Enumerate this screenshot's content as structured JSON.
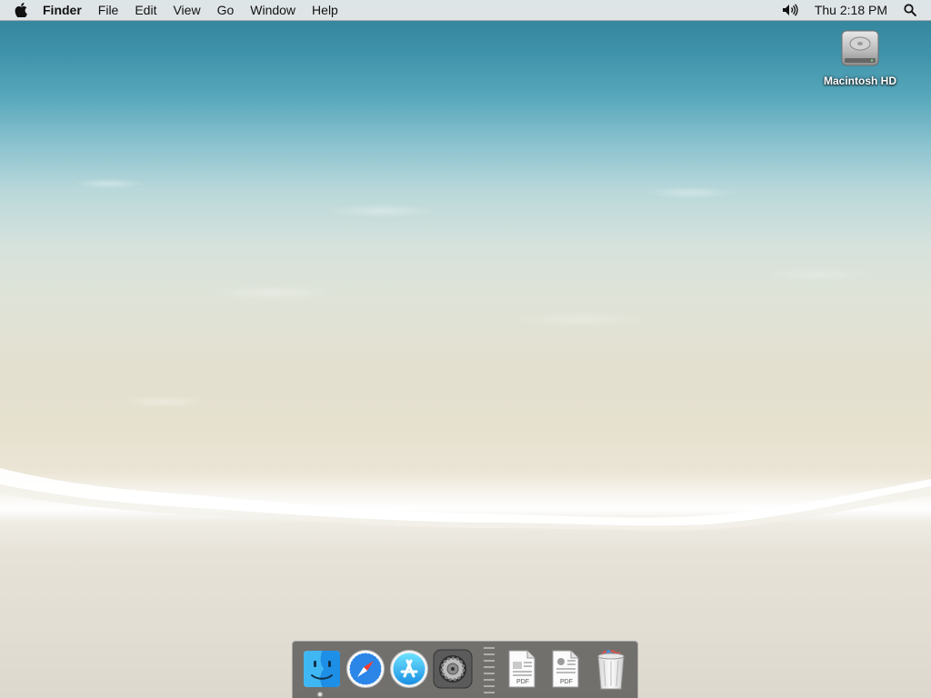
{
  "menubar": {
    "apple_icon": "apple-icon",
    "app_name": "Finder",
    "items": [
      "File",
      "Edit",
      "View",
      "Go",
      "Window",
      "Help"
    ],
    "clock": "Thu 2:18 PM",
    "volume_icon": "volume-icon",
    "search_icon": "spotlight-search-icon"
  },
  "desktop": {
    "icons": [
      {
        "label": "Macintosh HD",
        "icon": "hard-drive-icon"
      }
    ]
  },
  "dock": {
    "apps": [
      {
        "name": "Finder",
        "icon": "finder-icon",
        "running": true
      },
      {
        "name": "Safari",
        "icon": "safari-icon",
        "running": false
      },
      {
        "name": "App Store",
        "icon": "app-store-icon",
        "running": false
      },
      {
        "name": "System Preferences",
        "icon": "system-preferences-icon",
        "running": false
      }
    ],
    "documents": [
      {
        "label": "PDF",
        "icon": "pdf-document-icon"
      },
      {
        "label": "PDF",
        "icon": "pdf-document-icon"
      }
    ],
    "trash": {
      "icon": "trash-icon"
    }
  }
}
